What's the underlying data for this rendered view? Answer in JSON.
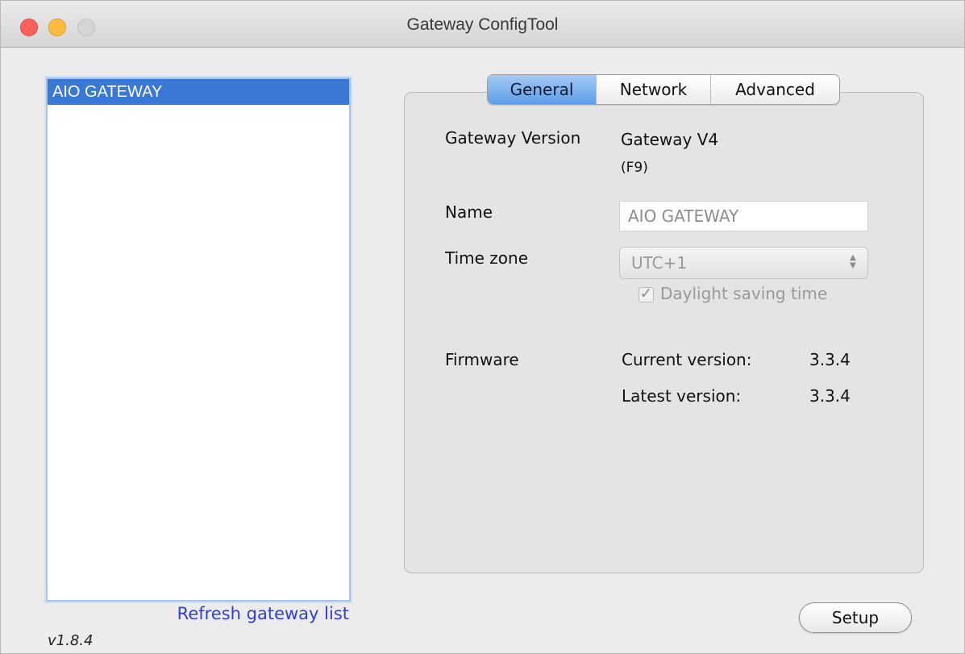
{
  "window": {
    "title": "Gateway ConfigTool"
  },
  "sidebar": {
    "items": [
      {
        "label": "AIO GATEWAY",
        "selected": true
      }
    ],
    "refresh_label": "Refresh gateway list",
    "version": "v1.8.4"
  },
  "tabs": [
    {
      "label": "General",
      "active": true
    },
    {
      "label": "Network",
      "active": false
    },
    {
      "label": "Advanced",
      "active": false
    }
  ],
  "general": {
    "gateway_version_label": "Gateway Version",
    "gateway_version_value_line1": "Gateway V4",
    "gateway_version_value_line2": "(F9)",
    "name_label": "Name",
    "name_value": "AIO GATEWAY",
    "timezone_label": "Time zone",
    "timezone_value": "UTC+1",
    "daylight_label": "Daylight saving time",
    "daylight_checked": true,
    "firmware_label": "Firmware",
    "current_version_label": "Current version:",
    "current_version_value": "3.3.4",
    "latest_version_label": "Latest version:",
    "latest_version_value": "3.3.4"
  },
  "footer": {
    "setup_label": "Setup"
  },
  "colors": {
    "selection": "#3a78d5",
    "link": "#2f3fd8",
    "active_tab": "#5e9de6"
  }
}
